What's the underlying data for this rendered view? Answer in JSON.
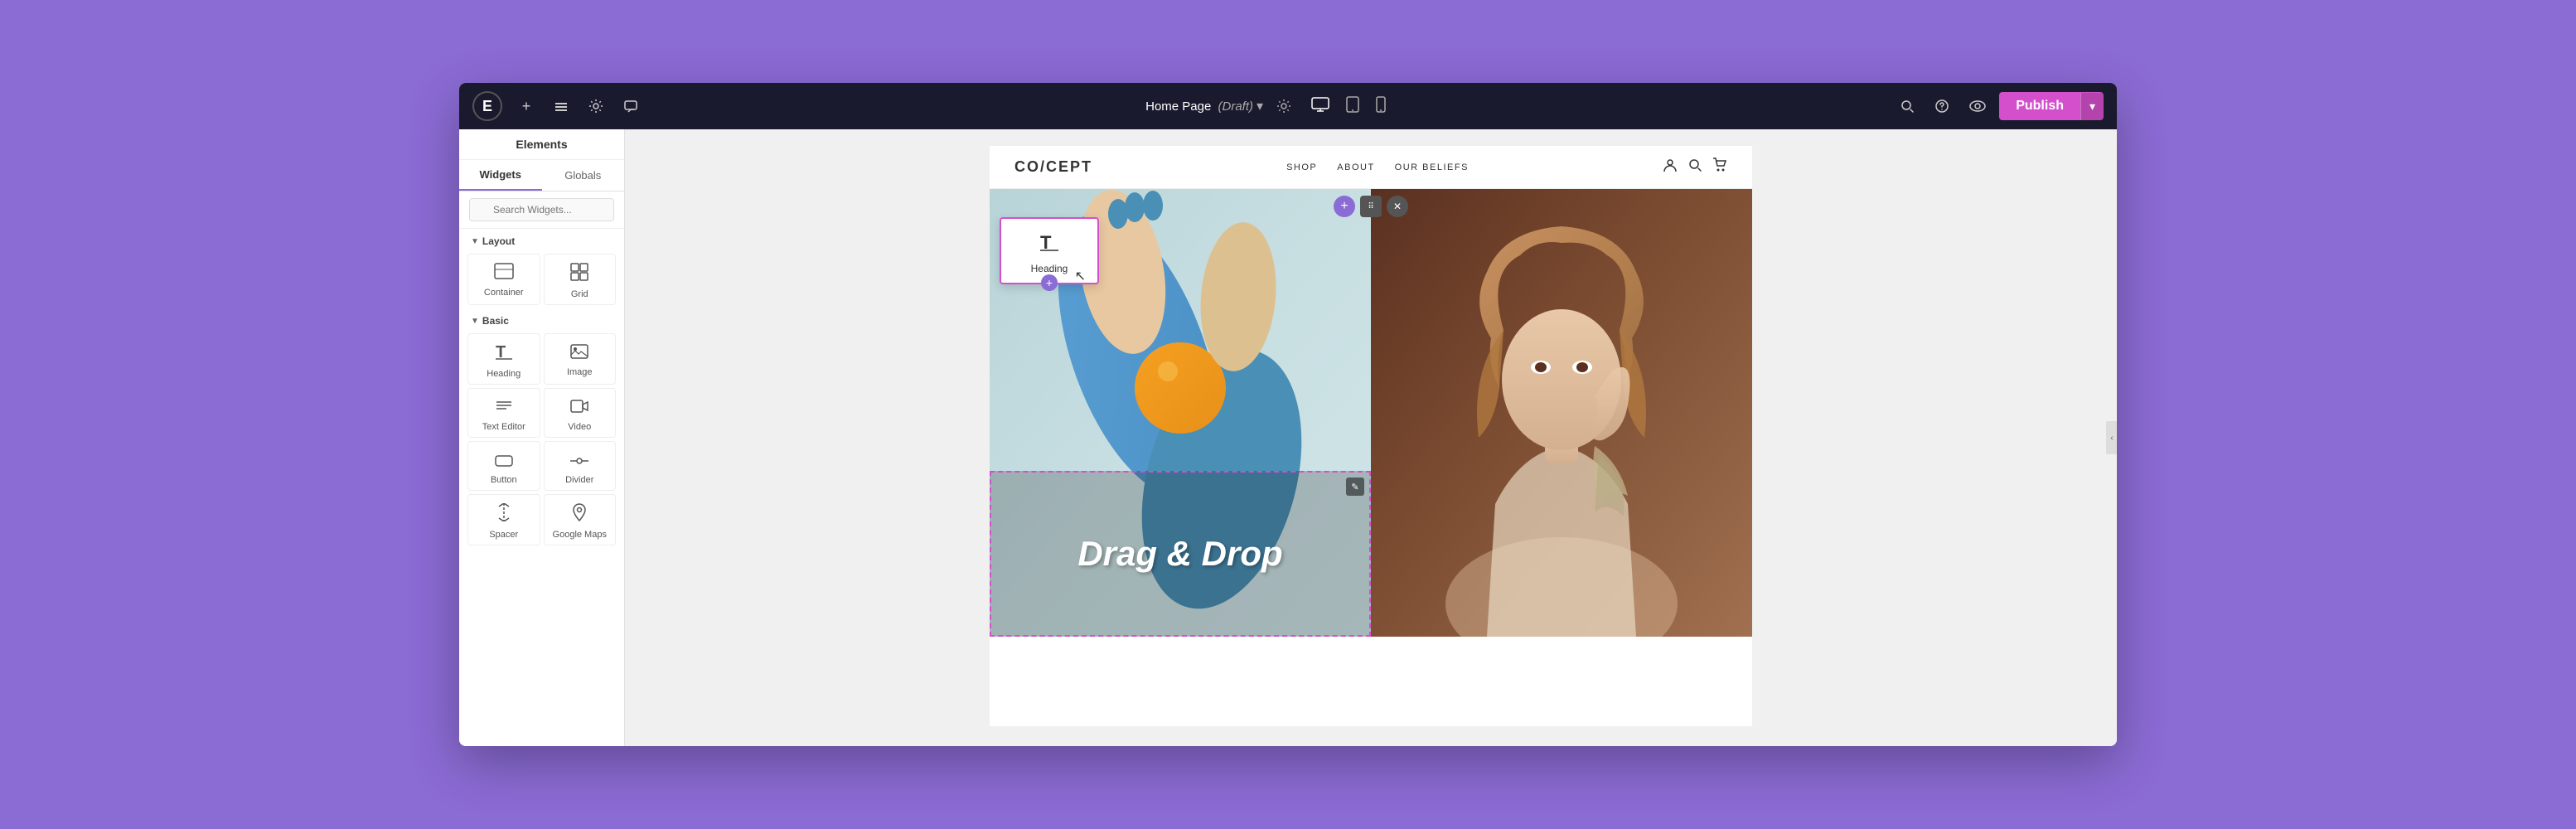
{
  "toolbar": {
    "logo_text": "E",
    "page_title": "Home Page",
    "page_draft": "(Draft)",
    "settings_icon": "⚙",
    "publish_label": "Publish",
    "dropdown_arrow": "▾",
    "icons": {
      "add": "+",
      "layers": "≡",
      "settings": "⚙",
      "chat": "💬",
      "search": "🔍",
      "help": "?",
      "preview": "👁",
      "desktop": "🖥",
      "tablet": "▭",
      "mobile": "📱"
    }
  },
  "left_panel": {
    "header": "Elements",
    "tabs": [
      {
        "label": "Widgets",
        "active": true
      },
      {
        "label": "Globals",
        "active": false
      }
    ],
    "search_placeholder": "Search Widgets...",
    "sections": {
      "layout": {
        "label": "Layout",
        "items": [
          {
            "label": "Container",
            "icon": "□"
          },
          {
            "label": "Grid",
            "icon": "▦"
          }
        ]
      },
      "basic": {
        "label": "Basic",
        "items": [
          {
            "label": "Heading",
            "icon": "T"
          },
          {
            "label": "Image",
            "icon": "🖼"
          },
          {
            "label": "Text Editor",
            "icon": "≡"
          },
          {
            "label": "Video",
            "icon": "▶"
          },
          {
            "label": "Button",
            "icon": "⬜"
          },
          {
            "label": "Divider",
            "icon": "✛"
          },
          {
            "label": "Spacer",
            "icon": "↕"
          },
          {
            "label": "Google Maps",
            "icon": "📍"
          }
        ]
      }
    }
  },
  "canvas": {
    "add_section_controls": {
      "plus_label": "+",
      "move_label": "⋮⋮⋮",
      "close_label": "✕"
    }
  },
  "website": {
    "logo": "CO/CEPT",
    "nav_items": [
      "SHOP",
      "ABOUT",
      "OUR BELIEFS"
    ],
    "hero": {
      "heading_widget_label": "Heading",
      "drag_drop_text": "Drag & Drop",
      "edit_icon": "✎"
    }
  },
  "colors": {
    "accent_purple": "#8B6BD4",
    "accent_pink": "#d44fcc",
    "toolbar_bg": "#1a1a2e",
    "publish_bg": "#d44fcc"
  }
}
